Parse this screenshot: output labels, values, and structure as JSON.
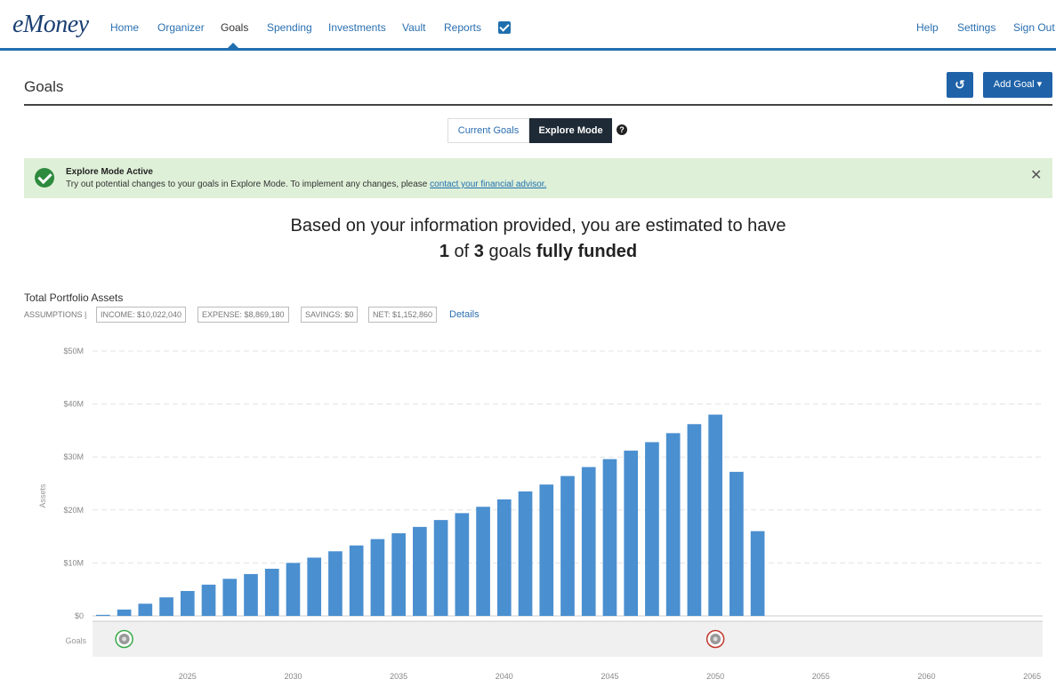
{
  "app": {
    "logo": "eMoney"
  },
  "nav": {
    "left": [
      "Home",
      "Organizer",
      "Goals",
      "Spending",
      "Investments",
      "Vault",
      "Reports"
    ],
    "right": [
      "Help",
      "Settings",
      "Sign Out"
    ],
    "active": "Goals"
  },
  "page": {
    "title": "Goals",
    "add_goal_label": "Add Goal ▾",
    "refresh_icon": "refresh-icon"
  },
  "mode": {
    "current_label": "Current Goals",
    "explore_label": "Explore Mode",
    "help_glyph": "?"
  },
  "alert": {
    "title": "Explore Mode Active",
    "text": "Try out potential changes to your goals in Explore Mode. To implement any changes, please ",
    "link_text": "contact your financial advisor.",
    "close_glyph": "✕"
  },
  "summary": {
    "line1": "Based on your information provided, you are estimated to have",
    "funded": "1",
    "of": " of ",
    "total": "3",
    "goals_word": " goals ",
    "status": "fully funded"
  },
  "portfolio": {
    "title": "Total Portfolio Assets",
    "assumptions_label": "ASSUMPTIONS |",
    "income": "INCOME: $10,022,040",
    "expense": "EXPENSE: $8,869,180",
    "savings": "SAVINGS: $0",
    "net": "NET: $1,152,860",
    "details_link": "Details"
  },
  "colors": {
    "accent": "#1f6faf",
    "bar": "#4a8fd0",
    "alert_bg": "#dff0d8"
  },
  "chart_data": {
    "type": "bar",
    "ylabel": "Assets",
    "goals_row_label": "Goals",
    "ylim": [
      0,
      50
    ],
    "y_ticks": [
      "$0",
      "$10M",
      "$20M",
      "$30M",
      "$40M",
      "$50M"
    ],
    "x_ticks": [
      "2025",
      "2030",
      "2035",
      "2040",
      "2045",
      "2050",
      "2055",
      "2060",
      "2065"
    ],
    "x_tick_values": [
      2025,
      2030,
      2035,
      2040,
      2045,
      2050,
      2055,
      2060,
      2065
    ],
    "xlim": [
      2020.5,
      2065.5
    ],
    "unit": "$M",
    "x": [
      2021,
      2022,
      2023,
      2024,
      2025,
      2026,
      2027,
      2028,
      2029,
      2030,
      2031,
      2032,
      2033,
      2034,
      2035,
      2036,
      2037,
      2038,
      2039,
      2040,
      2041,
      2042,
      2043,
      2044,
      2045,
      2046,
      2047,
      2048,
      2049,
      2050,
      2051,
      2052
    ],
    "values": [
      0.2,
      1.2,
      2.3,
      3.5,
      4.7,
      5.9,
      7.0,
      7.9,
      8.9,
      10.0,
      11.0,
      12.2,
      13.3,
      14.5,
      15.6,
      16.8,
      18.1,
      19.4,
      20.6,
      22.0,
      23.5,
      24.8,
      26.4,
      28.1,
      29.6,
      31.2,
      32.8,
      34.5,
      36.2,
      38.0,
      27.2,
      16.0
    ],
    "goal_markers": [
      {
        "year": 2022,
        "status": "funded",
        "color": "#3aa94a"
      },
      {
        "year": 2050,
        "status": "not-funded",
        "color": "#c0392b"
      }
    ],
    "grid": true
  }
}
